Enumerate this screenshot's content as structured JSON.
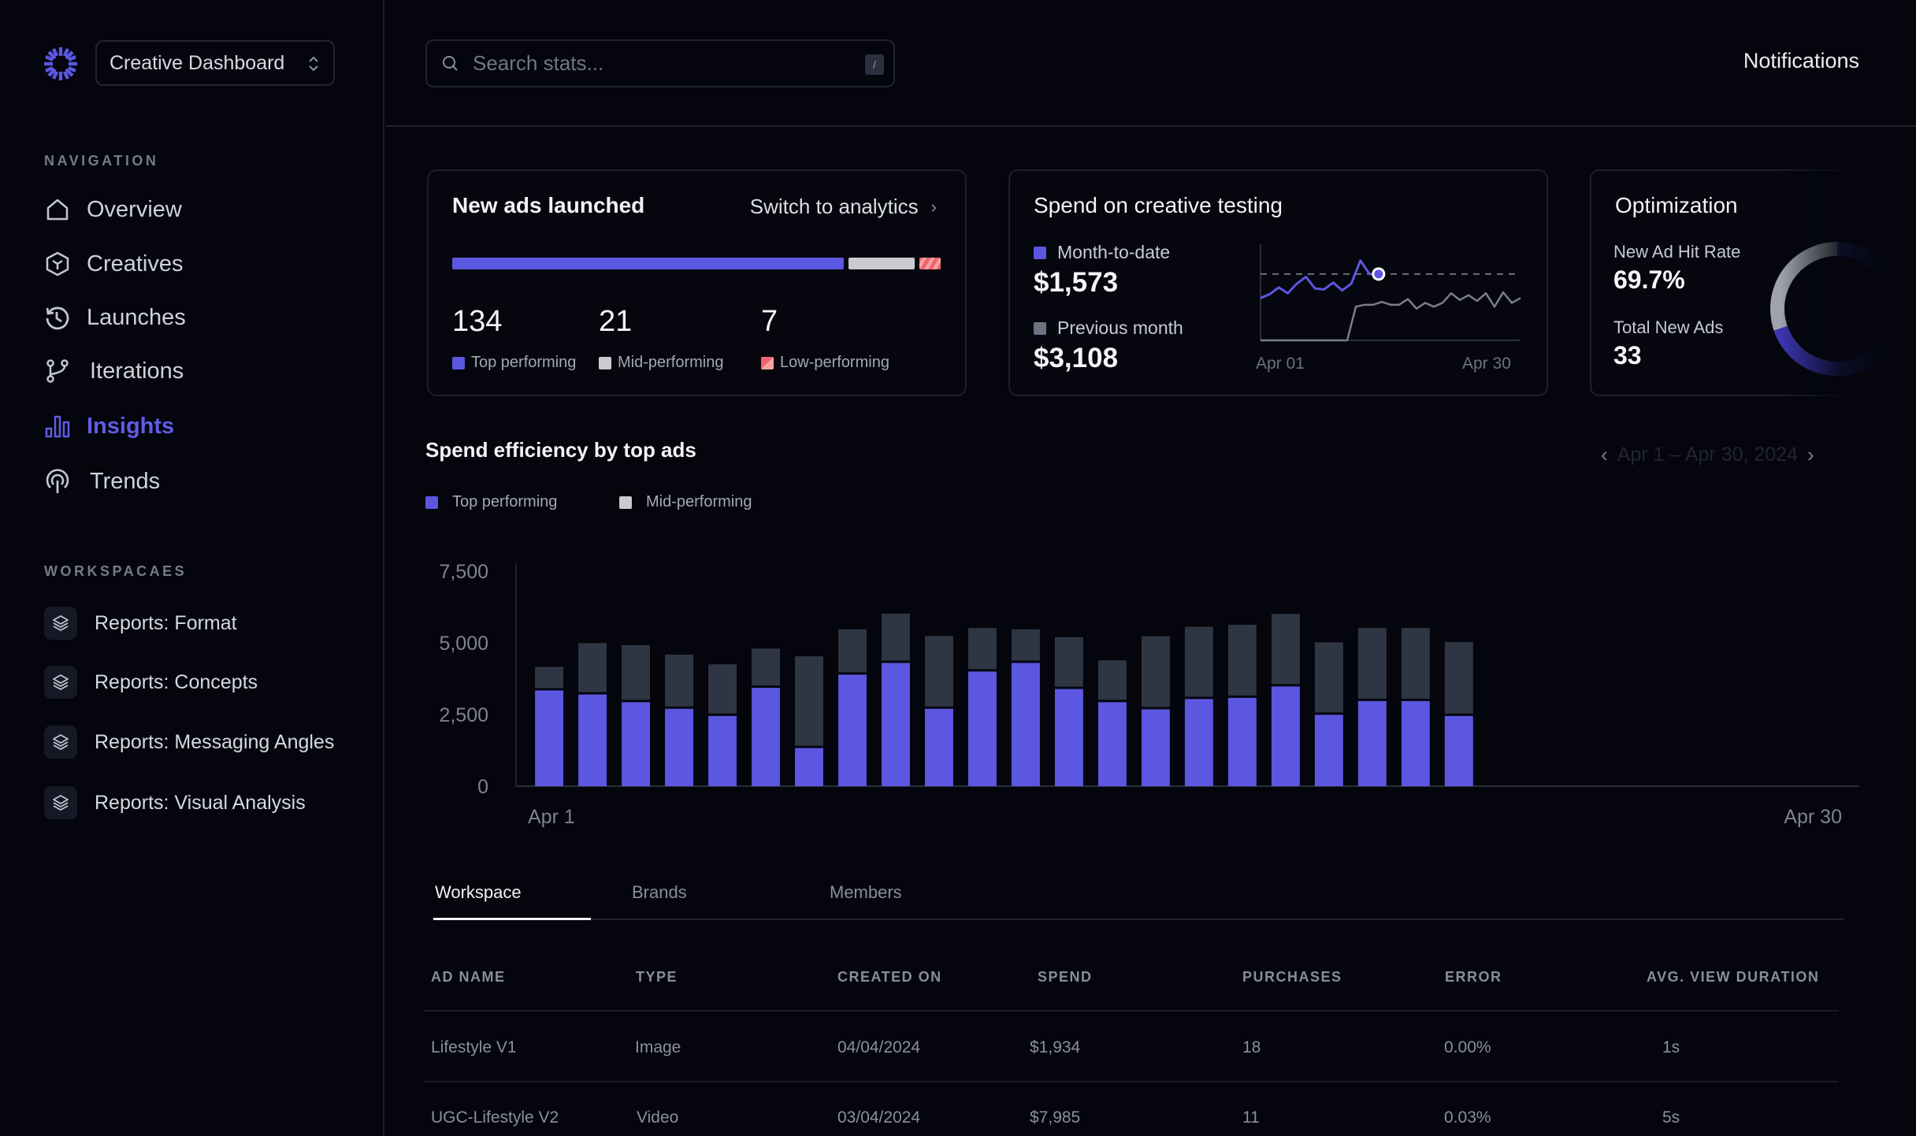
{
  "sidebar": {
    "workspace_selector": "Creative Dashboard",
    "navigation_label": "NAVIGATION",
    "nav_items": [
      {
        "label": "Overview",
        "icon": "home-icon",
        "active": false
      },
      {
        "label": "Creatives",
        "icon": "cube-icon",
        "active": false
      },
      {
        "label": "Launches",
        "icon": "history-icon",
        "active": false
      },
      {
        "label": "Iterations",
        "icon": "git-branch-icon",
        "active": false
      },
      {
        "label": "Insights",
        "icon": "bar-chart-icon",
        "active": true
      },
      {
        "label": "Trends",
        "icon": "broadcast-icon",
        "active": false
      }
    ],
    "workspaces_label": "WORKSPACAES",
    "workspaces": [
      {
        "label": "Reports: Format",
        "icon": "layers-icon"
      },
      {
        "label": "Reports: Concepts",
        "icon": "layers-icon"
      },
      {
        "label": "Reports: Messaging Angles",
        "icon": "layers-icon"
      },
      {
        "label": "Reports: Visual Analysis",
        "icon": "layers-icon"
      }
    ]
  },
  "header": {
    "search_placeholder": "Search stats...",
    "search_value": "",
    "search_shortcut": "/",
    "notifications_label": "Notifications"
  },
  "colors": {
    "accent": "#5b57e0",
    "mid": "#c9cbd1",
    "low": "#f0656b",
    "dark_bar": "#2f3643",
    "background": "#04050d"
  },
  "cards": {
    "new_ads": {
      "title": "New ads launched",
      "link": "Switch to analytics",
      "stats": [
        {
          "value": "134",
          "label": "Top performing",
          "count": 134
        },
        {
          "value": "21",
          "label": "Mid-performing",
          "count": 21
        },
        {
          "value": "7",
          "label": "Low-performing",
          "count": 7
        }
      ]
    },
    "spend": {
      "title": "Spend on creative testing",
      "month_to_date_label": "Month-to-date",
      "month_to_date_value": "$1,573",
      "previous_month_label": "Previous month",
      "previous_month_value": "$3,108",
      "x_start": "Apr 01",
      "x_end": "Apr 30",
      "sparkline": {
        "target": 69,
        "month_to_date": [
          44,
          48,
          55,
          49,
          59,
          66,
          54,
          53,
          60,
          52,
          59,
          83,
          69,
          69
        ],
        "previous_month": [
          0,
          0,
          0,
          0,
          0,
          0,
          0,
          0,
          0,
          0,
          0,
          35,
          37,
          37,
          40,
          37,
          37,
          43,
          33,
          39,
          35,
          39,
          49,
          42,
          47,
          41,
          49,
          35,
          50,
          39,
          44
        ]
      }
    },
    "optimization": {
      "title": "Optimization",
      "hit_rate_label": "New Ad Hit Rate",
      "hit_rate_value": "69.7%",
      "hit_rate": 69.7,
      "total_label": "Total New Ads",
      "total_value": "33"
    }
  },
  "chart_data": {
    "type": "bar",
    "stacked": true,
    "title": "Spend efficiency by top ads",
    "date_range": "Apr 1 – Apr 30, 2024",
    "legend": [
      "Top performing",
      "Mid-performing"
    ],
    "legend_position": "top-left",
    "xlabel": "",
    "ylabel": "",
    "x_tick_labels": [
      "Apr 1",
      "Apr 30"
    ],
    "y_ticks": [
      0,
      2500,
      5000,
      7500
    ],
    "y_tick_labels": [
      "0",
      "2,500",
      "5,000",
      "7,500"
    ],
    "ylim": [
      0,
      7500
    ],
    "x_slots": 30,
    "grid": false,
    "series": [
      {
        "name": "Top performing",
        "values": [
          3340,
          3200,
          2930,
          2700,
          2450,
          3430,
          1330,
          3890,
          4300,
          2700,
          4000,
          4300,
          3390,
          2930,
          2680,
          3040,
          3080,
          3480,
          2490,
          2970,
          2970,
          2450
        ]
      },
      {
        "name": "Mid-performing",
        "values": [
          820,
          1790,
          1990,
          1890,
          1800,
          1370,
          3200,
          1580,
          1720,
          2540,
          1520,
          1170,
          1810,
          1460,
          2550,
          2520,
          2550,
          2530,
          2530,
          2550,
          2550,
          2580
        ]
      }
    ]
  },
  "tabs": [
    {
      "label": "Workspace",
      "active": true
    },
    {
      "label": "Brands",
      "active": false
    },
    {
      "label": "Members",
      "active": false
    }
  ],
  "table": {
    "columns": [
      "AD NAME",
      "TYPE",
      "CREATED ON",
      "SPEND",
      "PURCHASES",
      "ERROR",
      "AVG. VIEW DURATION"
    ],
    "rows": [
      [
        "Lifestyle V1",
        "Image",
        "04/04/2024",
        "$1,934",
        "18",
        "0.00%",
        "1s"
      ],
      [
        "UGC-Lifestyle V2",
        "Video",
        "03/04/2024",
        "$7,985",
        "11",
        "0.03%",
        "5s"
      ]
    ]
  }
}
